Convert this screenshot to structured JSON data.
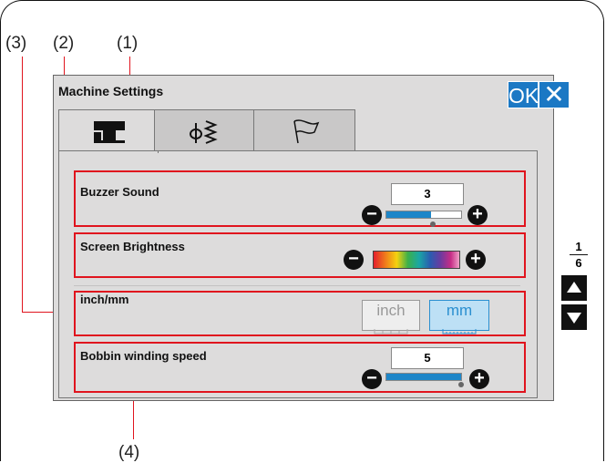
{
  "callouts": {
    "c1": "(1)",
    "c2": "(2)",
    "c3": "(3)",
    "c4": "(4)"
  },
  "window": {
    "title": "Machine Settings",
    "ok_label": "OK",
    "close_label": "✕"
  },
  "tabs": [
    {
      "icon": "sewing-machine-icon",
      "active": true
    },
    {
      "icon": "stitch-icon",
      "active": false
    },
    {
      "icon": "flag-icon",
      "active": false
    }
  ],
  "settings": {
    "buzzer": {
      "label": "Buzzer Sound",
      "value": "3",
      "level": 0.6
    },
    "brightness": {
      "label": "Screen Brightness"
    },
    "units": {
      "label": "inch/mm",
      "inch_label": "inch",
      "mm_label": "mm",
      "selected": "mm"
    },
    "bobbin": {
      "label": "Bobbin winding speed",
      "value": "5",
      "level": 1.0
    }
  },
  "pagination": {
    "current": "1",
    "total": "6"
  },
  "colors": {
    "accent": "#1b78c4",
    "callout_red": "#e0141e",
    "panel_bg": "#dddcdc"
  }
}
